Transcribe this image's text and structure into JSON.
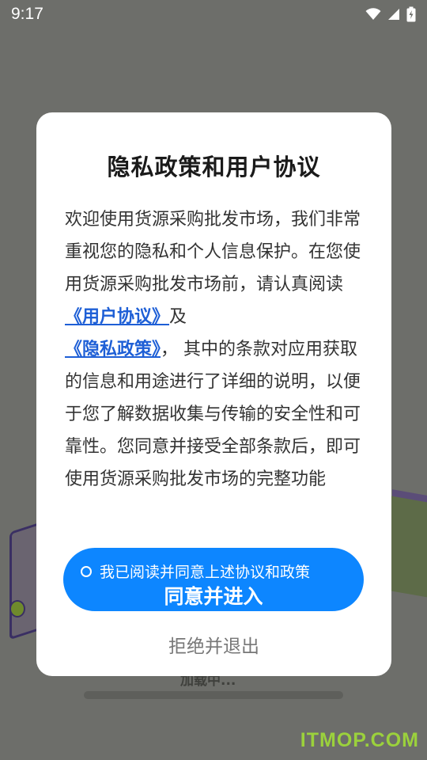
{
  "status_bar": {
    "time": "9:17",
    "icons": [
      "wifi-icon",
      "cell-signal-icon",
      "battery-charging-icon"
    ]
  },
  "background": {
    "loading_text": "加载中..."
  },
  "dialog": {
    "title": "隐私政策和用户协议",
    "body": {
      "intro": "欢迎使用货源采购批发市场，我们非常重视您的隐私和个人信息保护。在您使用货源采购批发市场前，请认真阅读",
      "user_agreement_link": "《用户协议》",
      "and": "及",
      "privacy_policy_link": "《隐私政策》",
      "outro": "， 其中的条款对应用获取的信息和用途进行了详细的说明，以便于您了解数据收集与传输的安全性和可靠性。您同意并接受全部条款后，即可使用货源采购批发市场的完整功能"
    },
    "agree_checkbox_label": "我已阅读并同意上述协议和政策",
    "agree_button_label": "同意并进入",
    "reject_button_label": "拒绝并退出"
  },
  "colors": {
    "accent": "#0d86ff",
    "link": "#1e5fd6",
    "watermark": "#9bd13c"
  },
  "watermark": "ITMOP.COM"
}
